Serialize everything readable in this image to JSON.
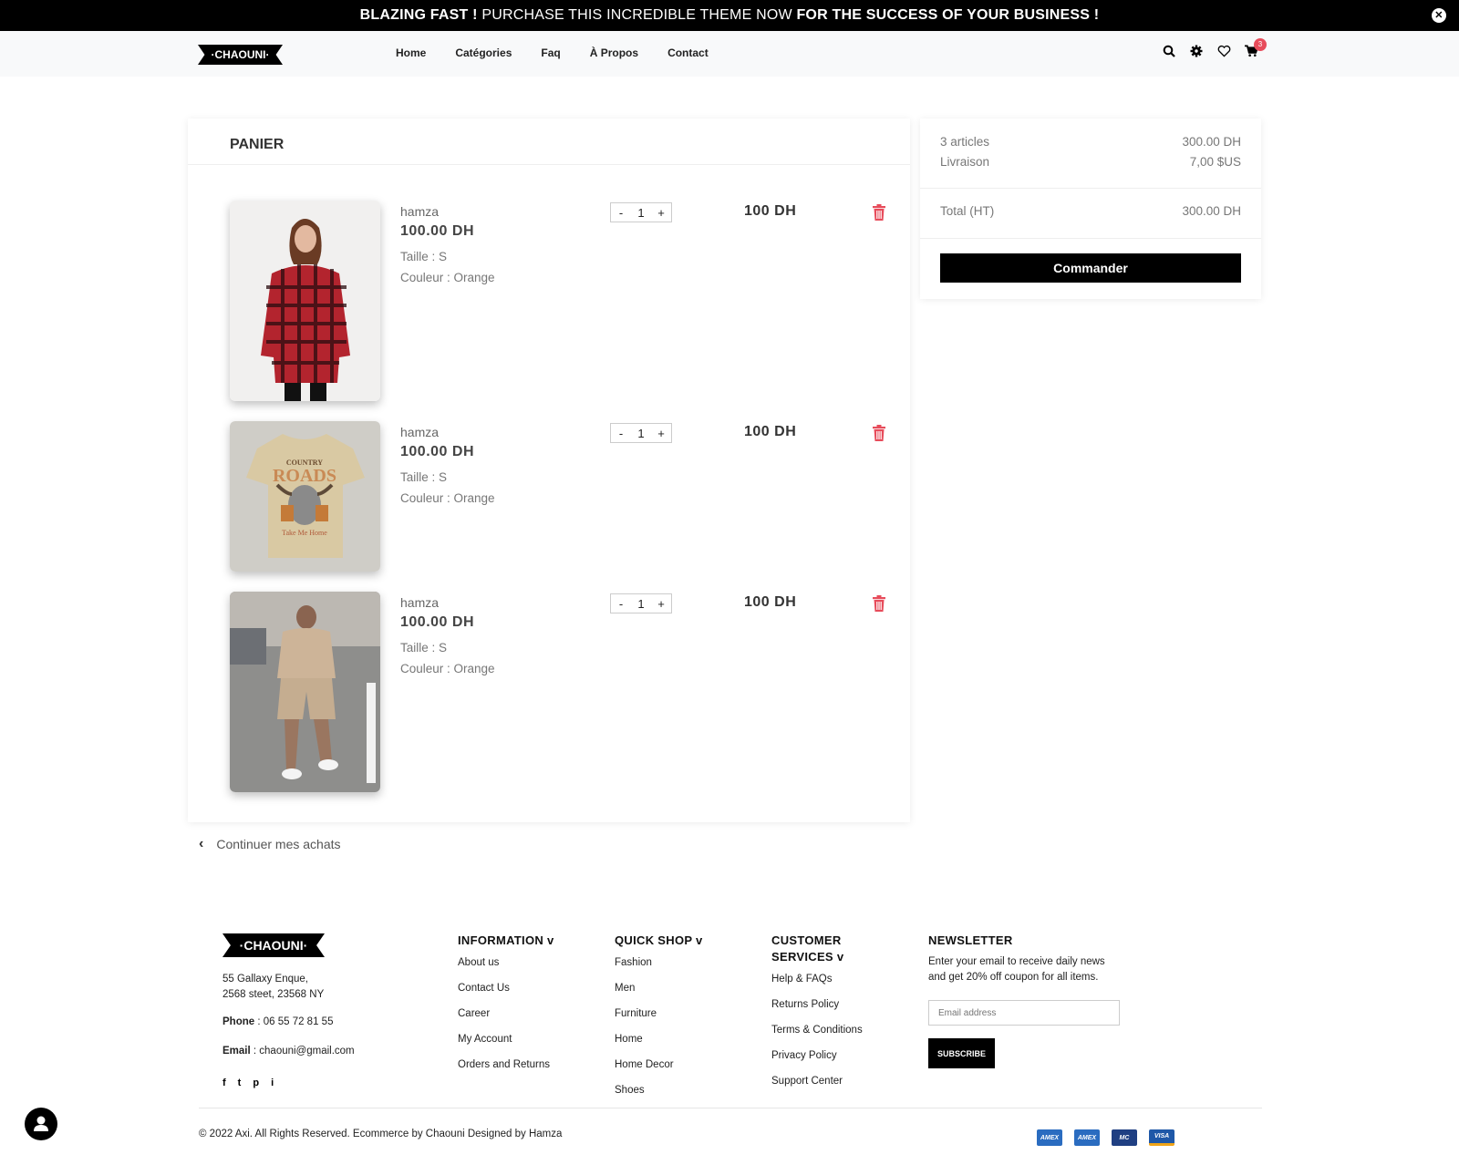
{
  "promo": {
    "bold1": "BLAZING FAST !",
    "regular": " PURCHASE THIS INCREDIBLE THEME NOW ",
    "bold2": "FOR THE SUCCESS OF YOUR BUSINESS !",
    "close_icon": "close-icon"
  },
  "header": {
    "logo": "·CHAOUNI·",
    "nav": [
      "Home",
      "Catégories",
      "Faq",
      "À Propos",
      "Contact"
    ],
    "icons": [
      "search-icon",
      "gear-icon",
      "heart-icon",
      "cart-icon"
    ],
    "cart_count": "3"
  },
  "cart": {
    "title": "PANIER",
    "items": [
      {
        "name": "hamza",
        "price": "100.00  DH",
        "size": "Taille : S",
        "color": "Couleur : Orange",
        "qty": "1",
        "total": "100  DH",
        "image": "red-plaid-shirt"
      },
      {
        "name": "hamza",
        "price": "100.00  DH",
        "size": "Taille : S",
        "color": "Couleur : Orange",
        "qty": "1",
        "total": "100  DH",
        "image": "beige-printed-tshirt"
      },
      {
        "name": "hamza",
        "price": "100.00  DH",
        "size": "Taille : S",
        "color": "Couleur : Orange",
        "qty": "1",
        "total": "100  DH",
        "image": "beige-tshirt-shorts-set"
      }
    ],
    "minus": "-",
    "plus": "+",
    "continue": "Continuer mes achats"
  },
  "summary": {
    "articles_label": "3 articles",
    "articles_value": "300.00  DH",
    "shipping_label": "Livraison",
    "shipping_value": "7,00 $US",
    "total_label": "Total (HT)",
    "total_value": "300.00  DH",
    "order_button": "Commander"
  },
  "footer": {
    "logo": "·CHAOUNI·",
    "address_line1": "55 Gallaxy Enque,",
    "address_line2": "2568 steet, 23568 NY",
    "phone_label": "Phone",
    "phone": " : 06 55 72 81 55",
    "email_label": "Email",
    "email": " : chaouni@gmail.com",
    "social": [
      "f",
      "t",
      "p",
      "i"
    ],
    "information": {
      "title": "INFORMATION v",
      "links": [
        "About us",
        "Contact Us",
        "Career",
        "My Account",
        "Orders and Returns"
      ]
    },
    "quickshop": {
      "title": "QUICK SHOP v",
      "links": [
        "Fashion",
        "Men",
        "Furniture",
        "Home",
        "Home Decor",
        "Shoes"
      ]
    },
    "customer": {
      "title_line1": "CUSTOMER",
      "title_line2": "SERVICES v",
      "links": [
        "Help & FAQs",
        "Returns Policy",
        "Terms & Conditions",
        "Privacy Policy",
        "Support Center"
      ]
    },
    "newsletter": {
      "title": "NEWSLETTER",
      "text": "Enter your email to receive daily news and get 20% off coupon for all items.",
      "placeholder": "Email address",
      "button": "SUBSCRIBE"
    },
    "copyright": "© 2022 Axi. All Rights Reserved. Ecommerce by Chaouni Designed by Hamza",
    "payments": [
      "AMEX",
      "AMEX",
      "MC",
      "VISA"
    ]
  },
  "colors": {
    "accent_red": "#e74c5b",
    "black": "#000000"
  }
}
